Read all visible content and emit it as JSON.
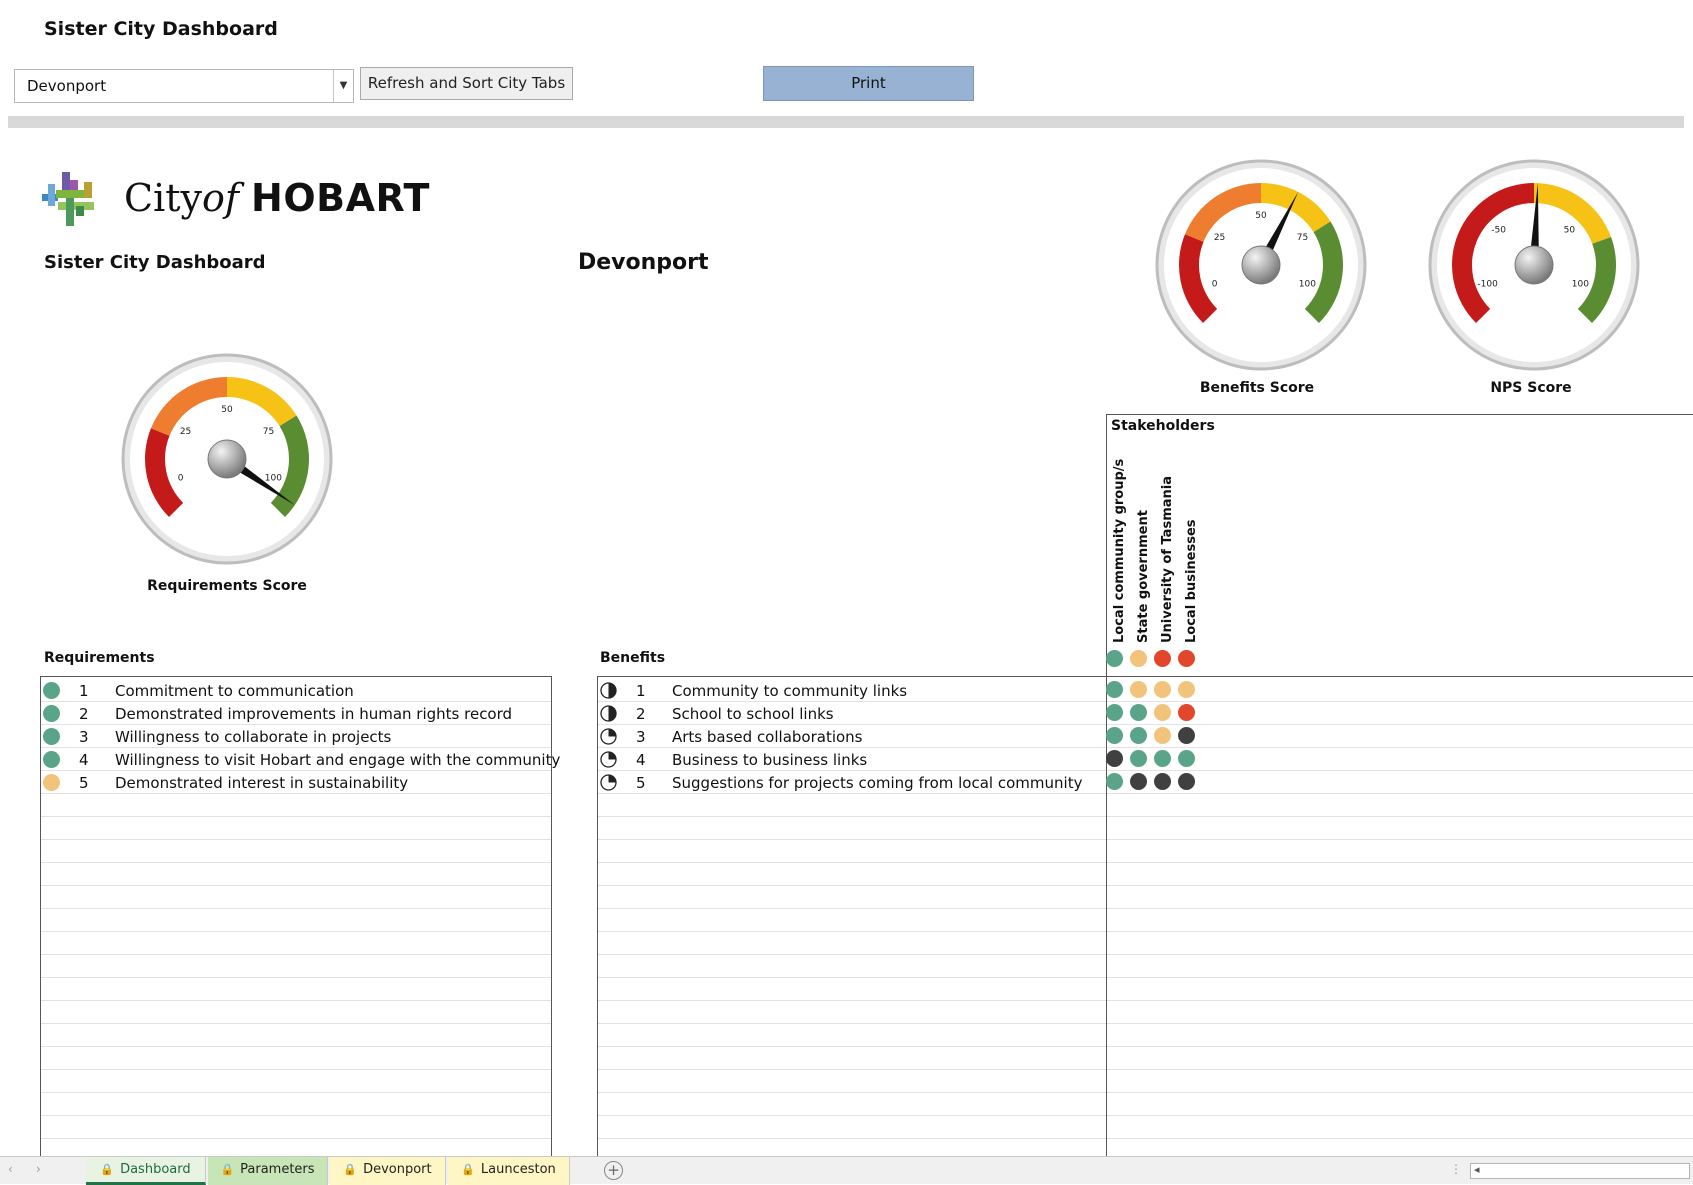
{
  "header": {
    "title": "Sister City Dashboard",
    "city_select_value": "Devonport",
    "refresh_label": "Refresh and Sort City Tabs",
    "print_label": "Print"
  },
  "logo": {
    "city": "City",
    "of": "of",
    "hobart": "HOBART"
  },
  "dashboard": {
    "subtitle": "Sister City Dashboard",
    "selected_city": "Devonport"
  },
  "gauges": {
    "requirements": {
      "label": "Requirements Score",
      "ticks": [
        "0",
        "25",
        "50",
        "75",
        "100"
      ],
      "value": 96
    },
    "benefits": {
      "label": "Benefits Score",
      "ticks": [
        "0",
        "25",
        "50",
        "75",
        "100"
      ],
      "value": 60
    },
    "nps": {
      "label": "NPS Score",
      "ticks": [
        "-100",
        "-50",
        "50",
        "100"
      ],
      "value": 2
    }
  },
  "requirements": {
    "title": "Requirements",
    "rows": [
      {
        "num": "1",
        "text": "Commitment to communication",
        "status": "green"
      },
      {
        "num": "2",
        "text": "Demonstrated improvements in human rights record",
        "status": "green"
      },
      {
        "num": "3",
        "text": "Willingness to collaborate in projects",
        "status": "green"
      },
      {
        "num": "4",
        "text": "Willingness to visit Hobart and engage with the community",
        "status": "green"
      },
      {
        "num": "5",
        "text": "Demonstrated interest in sustainability",
        "status": "amber"
      }
    ]
  },
  "benefits": {
    "title": "Benefits",
    "rows": [
      {
        "num": "1",
        "text": "Community to community links",
        "fill": 0.5
      },
      {
        "num": "2",
        "text": "School to school links",
        "fill": 0.5
      },
      {
        "num": "3",
        "text": "Arts based collaborations",
        "fill": 0.25
      },
      {
        "num": "4",
        "text": "Business to business links",
        "fill": 0.25
      },
      {
        "num": "5",
        "text": "Suggestions for projects coming from local community",
        "fill": 0.25
      }
    ]
  },
  "stakeholders": {
    "title": "Stakeholders",
    "columns": [
      "Local community group/s",
      "State government",
      "University of Tasmania",
      "Local businesses"
    ],
    "header_status": [
      "green",
      "amber",
      "red",
      "red"
    ],
    "rows": [
      [
        "green",
        "amber",
        "amber",
        "amber"
      ],
      [
        "green",
        "green",
        "amber",
        "red"
      ],
      [
        "green",
        "green",
        "amber",
        "dark"
      ],
      [
        "dark",
        "green",
        "green",
        "green"
      ],
      [
        "green",
        "dark",
        "dark",
        "dark"
      ]
    ]
  },
  "status_colors": {
    "green": "#5aa489",
    "amber": "#f2c37a",
    "red": "#e2472b",
    "dark": "#404040"
  },
  "sheet_tabs": [
    {
      "label": "Dashboard",
      "color": "#e9f3e3",
      "active": true
    },
    {
      "label": "Parameters",
      "color": "#c7e5b7",
      "active": false
    },
    {
      "label": "Devonport",
      "color": "#fff6c6",
      "active": false
    },
    {
      "label": "Launceston",
      "color": "#fff6c6",
      "active": false
    }
  ]
}
